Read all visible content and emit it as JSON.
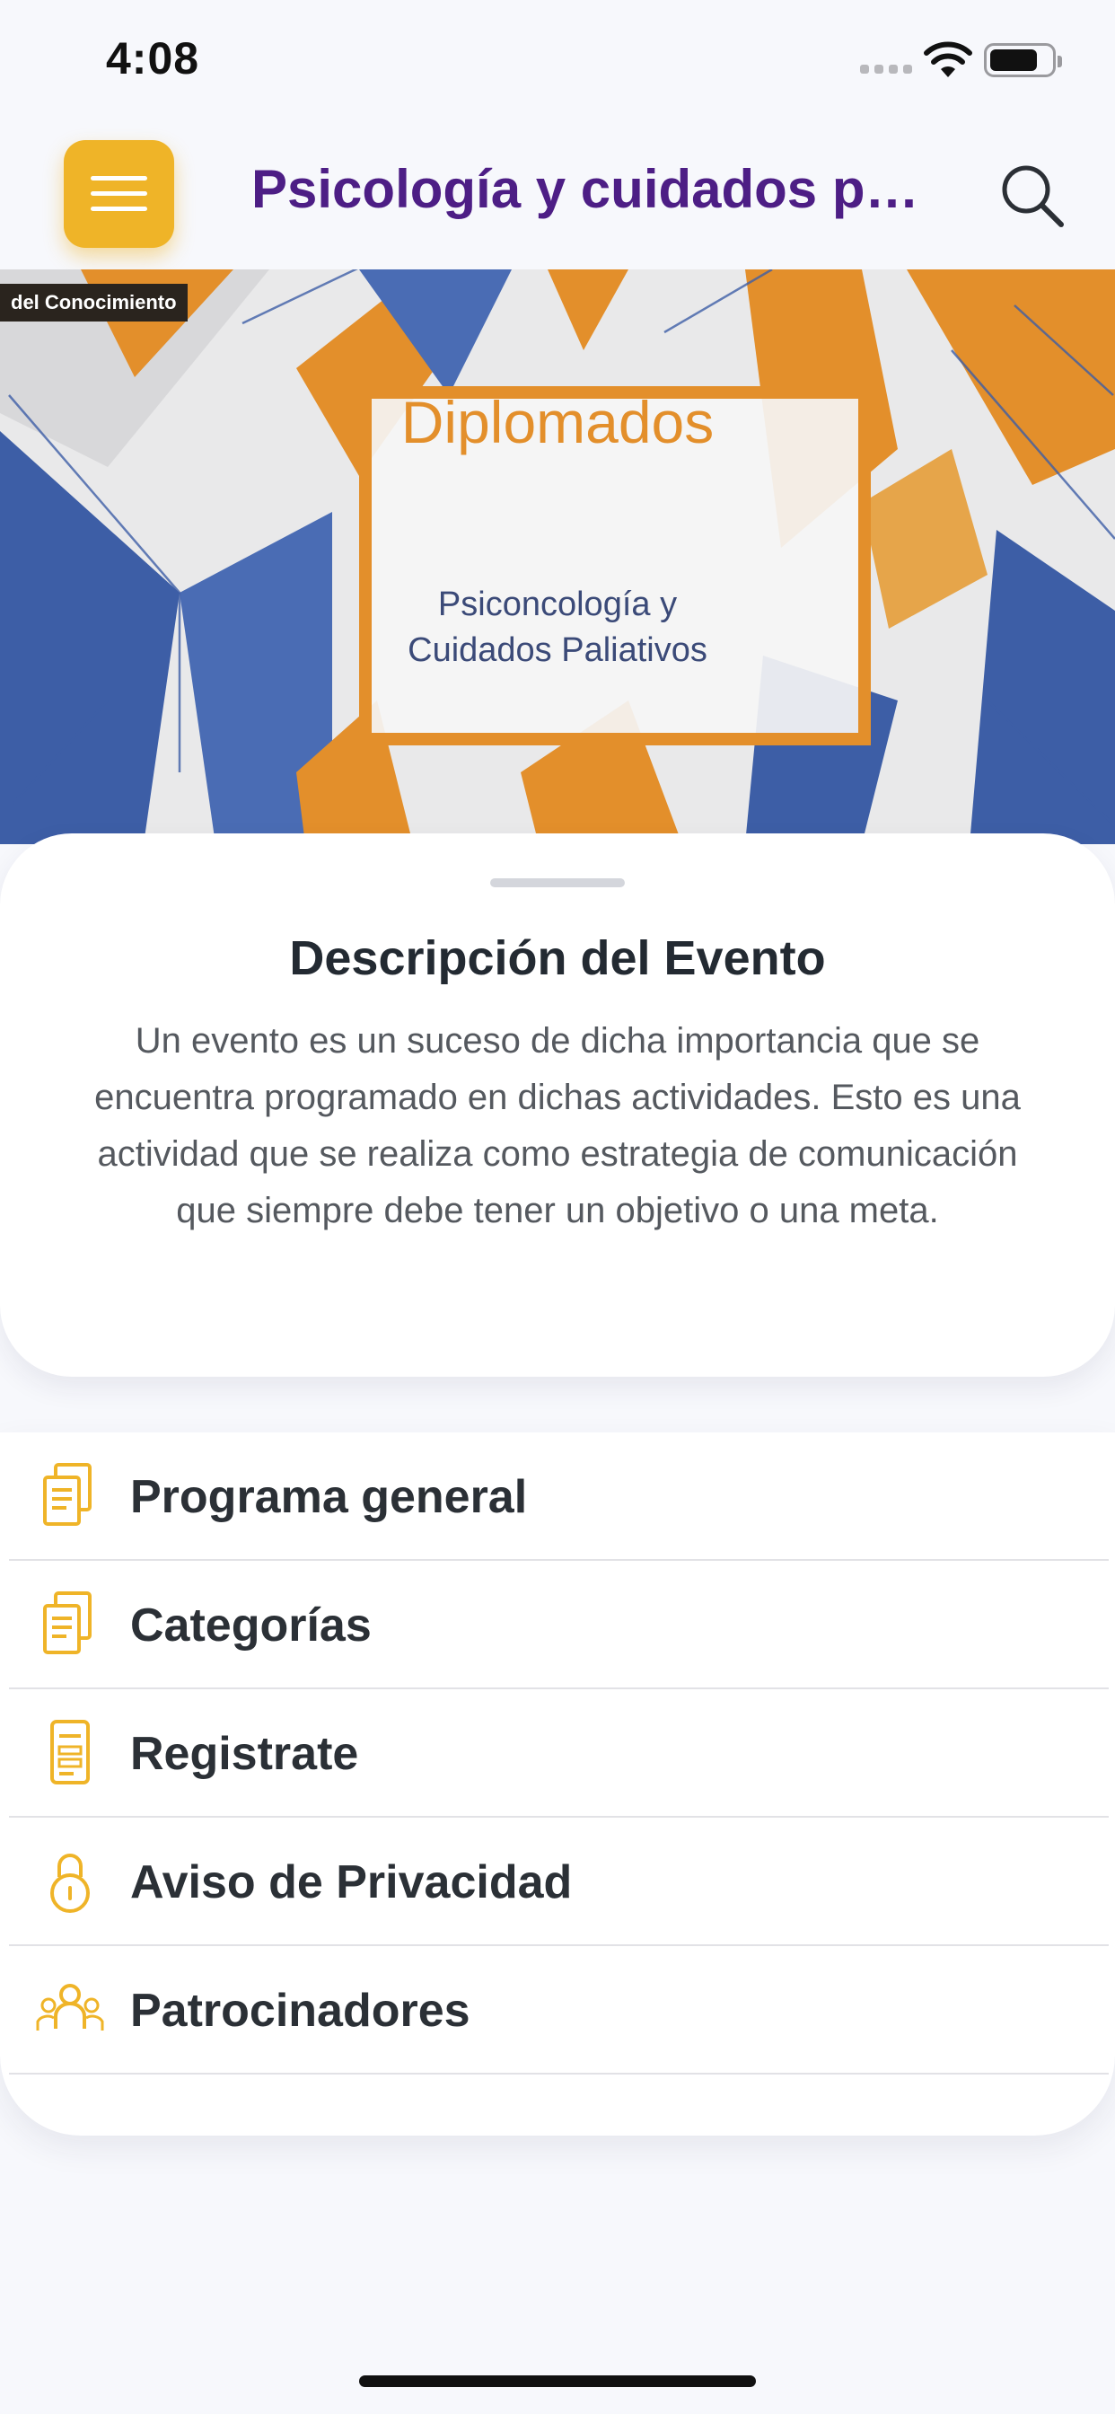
{
  "status_bar": {
    "time": "4:08"
  },
  "header": {
    "title": "Psicología y cuidados paliativos",
    "menu_icon": "hamburger-icon",
    "search_icon": "search-icon"
  },
  "banner": {
    "tag": "del Conocimiento",
    "title": "Diplomados",
    "subtitle_line1": "Psiconcología y",
    "subtitle_line2": "Cuidados Paliativos"
  },
  "description": {
    "title": "Descripción del Evento",
    "body": "Un evento es un suceso de dicha importancia que se encuentra programado en dichas actividades. Esto es una actividad que se realiza como estrategia de comunicación que siempre debe tener un objetivo o una meta."
  },
  "menu": {
    "items": [
      {
        "label": "Programa general",
        "icon": "document-icon"
      },
      {
        "label": "Categorías",
        "icon": "document-icon"
      },
      {
        "label": "Registrate",
        "icon": "form-icon"
      },
      {
        "label": "Aviso de Privacidad",
        "icon": "lock-icon"
      },
      {
        "label": "Patrocinadores",
        "icon": "people-icon"
      }
    ]
  },
  "colors": {
    "accent": "#efb428",
    "title": "#4d1e85",
    "banner_orange": "#e38f2b",
    "banner_blue": "#3d5ea6",
    "background": "#f7f8fc"
  }
}
